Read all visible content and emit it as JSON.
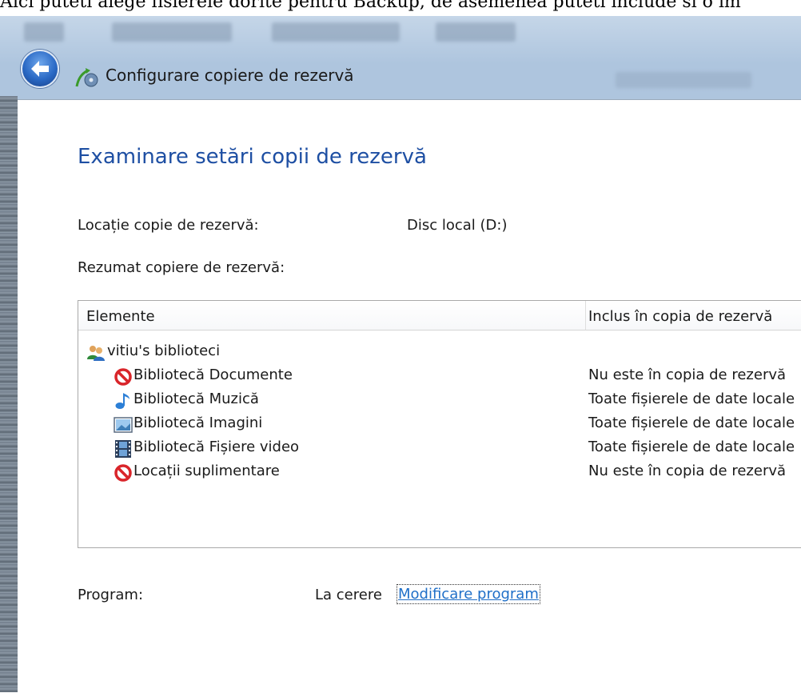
{
  "page_top_text": "Aici puteti alege fisierele dorite pentru Backup, de asemenea puteti include si o im",
  "blurred_background": {
    "menu_items": [
      "Organizare",
      "Partajare cu",
      "Inscriptionare",
      "Folder nou"
    ],
    "column_header": "Data modificarii"
  },
  "window": {
    "title": "Configurare copiere de rezervă",
    "back_icon": "back-arrow-icon",
    "wizard_icon": "backup-wizard-icon"
  },
  "main": {
    "heading": "Examinare setări copii de rezervă",
    "location_label": "Locație copie de rezervă:",
    "location_value": "Disc local (D:)",
    "summary_label": "Rezumat copiere de rezervă:",
    "table": {
      "columns": [
        "Elemente",
        "Inclus în copia de rezervă"
      ],
      "rows": [
        {
          "label": "vitiu's biblioteci",
          "status": "",
          "icon": "users-icon",
          "level": 0
        },
        {
          "label": "Bibliotecă Documente",
          "status": "Nu este în copia de rezervă",
          "icon": "not-included-icon",
          "level": 1
        },
        {
          "label": "Bibliotecă Muzică",
          "status": "Toate fișierele de date locale",
          "icon": "music-note-icon",
          "level": 1
        },
        {
          "label": "Bibliotecă Imagini",
          "status": "Toate fișierele de date locale",
          "icon": "picture-icon",
          "level": 1
        },
        {
          "label": "Bibliotecă Fișiere video",
          "status": "Toate fișierele de date locale",
          "icon": "film-icon",
          "level": 1
        },
        {
          "label": "Locații suplimentare",
          "status": "Nu este în copia de rezervă",
          "icon": "not-included-icon",
          "level": 1
        }
      ]
    },
    "schedule_label": "Program:",
    "schedule_value": "La cerere",
    "change_schedule_link": "Modificare program"
  },
  "colors": {
    "heading": "#1e4fa3",
    "link": "#1f6fc8",
    "not_included": "#d9252a"
  }
}
